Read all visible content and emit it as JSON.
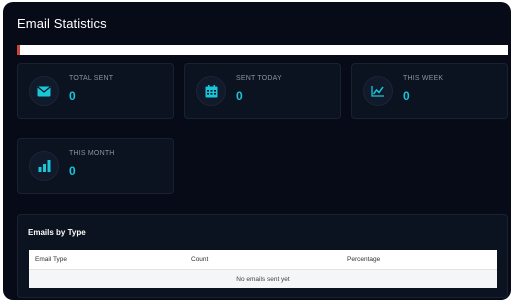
{
  "page": {
    "title": "Email Statistics"
  },
  "progress": {
    "fraction": 0.006,
    "color": "#c8453a"
  },
  "cards": [
    {
      "label": "TOTAL SENT",
      "value": "0",
      "icon": "envelope-icon"
    },
    {
      "label": "SENT TODAY",
      "value": "0",
      "icon": "calendar-icon"
    },
    {
      "label": "THIS WEEK",
      "value": "0",
      "icon": "line-chart-icon"
    },
    {
      "label": "THIS MONTH",
      "value": "0",
      "icon": "bar-chart-icon"
    }
  ],
  "emails_by_type": {
    "title": "Emails by Type",
    "columns": [
      "Email Type",
      "Count",
      "Percentage"
    ],
    "empty_text": "No emails sent yet"
  },
  "colors": {
    "accent": "#18c6d8",
    "background": "#070b17",
    "card": "#0b1220"
  }
}
